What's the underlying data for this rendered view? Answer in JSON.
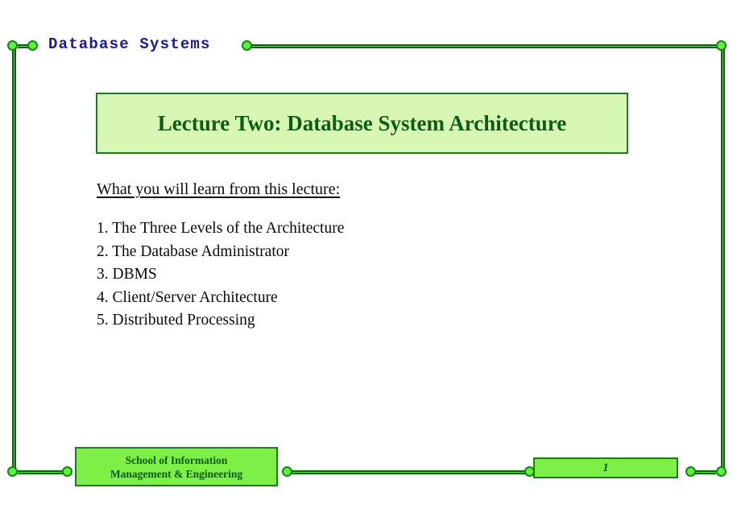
{
  "slide": {
    "header": {
      "course_title": "Database Systems"
    },
    "title_box": {
      "text": "Lecture Two: Database System Architecture"
    },
    "body": {
      "lead_line": "What you will learn from this lecture:",
      "items": [
        "1. The Three Levels of the Architecture",
        "2. The Database Administrator",
        "3. DBMS",
        "4. Client/Server Architecture",
        "5. Distributed Processing"
      ]
    },
    "footer": {
      "school_line1": "School of Information",
      "school_line2": "Management & Engineering",
      "page_number": "1"
    },
    "colors": {
      "frame_green": "#66dd44",
      "frame_outline": "#006600",
      "node_green": "#5ef03c",
      "title_box_bg": "#d9f7b4",
      "title_box_border": "#1f7a1f",
      "title_text": "#0d5c16",
      "footer_box_bg": "#7eef47",
      "course_title_color": "#1b1b8f",
      "body_text": "#0a0a0a"
    }
  }
}
